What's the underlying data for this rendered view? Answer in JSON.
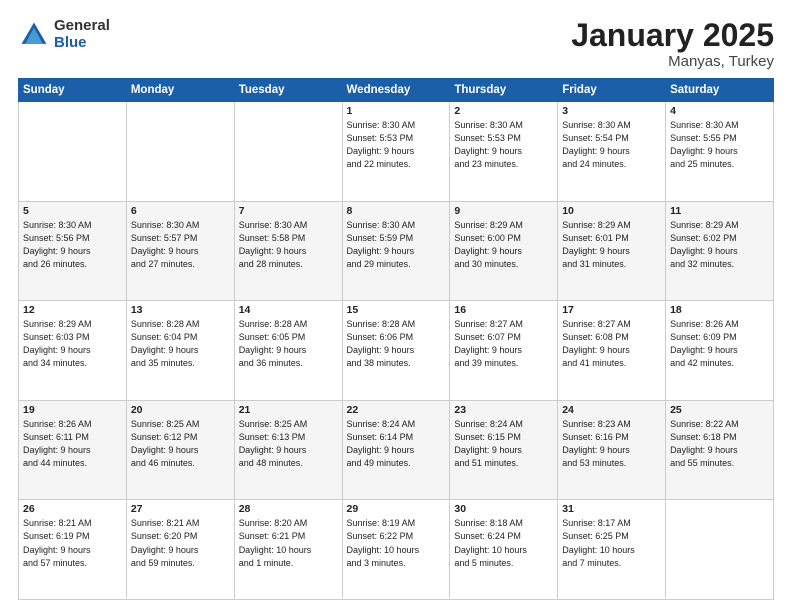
{
  "logo": {
    "general": "General",
    "blue": "Blue"
  },
  "title": {
    "month": "January 2025",
    "location": "Manyas, Turkey"
  },
  "weekdays": [
    "Sunday",
    "Monday",
    "Tuesday",
    "Wednesday",
    "Thursday",
    "Friday",
    "Saturday"
  ],
  "weeks": [
    [
      {
        "day": "",
        "info": ""
      },
      {
        "day": "",
        "info": ""
      },
      {
        "day": "",
        "info": ""
      },
      {
        "day": "1",
        "info": "Sunrise: 8:30 AM\nSunset: 5:53 PM\nDaylight: 9 hours\nand 22 minutes."
      },
      {
        "day": "2",
        "info": "Sunrise: 8:30 AM\nSunset: 5:53 PM\nDaylight: 9 hours\nand 23 minutes."
      },
      {
        "day": "3",
        "info": "Sunrise: 8:30 AM\nSunset: 5:54 PM\nDaylight: 9 hours\nand 24 minutes."
      },
      {
        "day": "4",
        "info": "Sunrise: 8:30 AM\nSunset: 5:55 PM\nDaylight: 9 hours\nand 25 minutes."
      }
    ],
    [
      {
        "day": "5",
        "info": "Sunrise: 8:30 AM\nSunset: 5:56 PM\nDaylight: 9 hours\nand 26 minutes."
      },
      {
        "day": "6",
        "info": "Sunrise: 8:30 AM\nSunset: 5:57 PM\nDaylight: 9 hours\nand 27 minutes."
      },
      {
        "day": "7",
        "info": "Sunrise: 8:30 AM\nSunset: 5:58 PM\nDaylight: 9 hours\nand 28 minutes."
      },
      {
        "day": "8",
        "info": "Sunrise: 8:30 AM\nSunset: 5:59 PM\nDaylight: 9 hours\nand 29 minutes."
      },
      {
        "day": "9",
        "info": "Sunrise: 8:29 AM\nSunset: 6:00 PM\nDaylight: 9 hours\nand 30 minutes."
      },
      {
        "day": "10",
        "info": "Sunrise: 8:29 AM\nSunset: 6:01 PM\nDaylight: 9 hours\nand 31 minutes."
      },
      {
        "day": "11",
        "info": "Sunrise: 8:29 AM\nSunset: 6:02 PM\nDaylight: 9 hours\nand 32 minutes."
      }
    ],
    [
      {
        "day": "12",
        "info": "Sunrise: 8:29 AM\nSunset: 6:03 PM\nDaylight: 9 hours\nand 34 minutes."
      },
      {
        "day": "13",
        "info": "Sunrise: 8:28 AM\nSunset: 6:04 PM\nDaylight: 9 hours\nand 35 minutes."
      },
      {
        "day": "14",
        "info": "Sunrise: 8:28 AM\nSunset: 6:05 PM\nDaylight: 9 hours\nand 36 minutes."
      },
      {
        "day": "15",
        "info": "Sunrise: 8:28 AM\nSunset: 6:06 PM\nDaylight: 9 hours\nand 38 minutes."
      },
      {
        "day": "16",
        "info": "Sunrise: 8:27 AM\nSunset: 6:07 PM\nDaylight: 9 hours\nand 39 minutes."
      },
      {
        "day": "17",
        "info": "Sunrise: 8:27 AM\nSunset: 6:08 PM\nDaylight: 9 hours\nand 41 minutes."
      },
      {
        "day": "18",
        "info": "Sunrise: 8:26 AM\nSunset: 6:09 PM\nDaylight: 9 hours\nand 42 minutes."
      }
    ],
    [
      {
        "day": "19",
        "info": "Sunrise: 8:26 AM\nSunset: 6:11 PM\nDaylight: 9 hours\nand 44 minutes."
      },
      {
        "day": "20",
        "info": "Sunrise: 8:25 AM\nSunset: 6:12 PM\nDaylight: 9 hours\nand 46 minutes."
      },
      {
        "day": "21",
        "info": "Sunrise: 8:25 AM\nSunset: 6:13 PM\nDaylight: 9 hours\nand 48 minutes."
      },
      {
        "day": "22",
        "info": "Sunrise: 8:24 AM\nSunset: 6:14 PM\nDaylight: 9 hours\nand 49 minutes."
      },
      {
        "day": "23",
        "info": "Sunrise: 8:24 AM\nSunset: 6:15 PM\nDaylight: 9 hours\nand 51 minutes."
      },
      {
        "day": "24",
        "info": "Sunrise: 8:23 AM\nSunset: 6:16 PM\nDaylight: 9 hours\nand 53 minutes."
      },
      {
        "day": "25",
        "info": "Sunrise: 8:22 AM\nSunset: 6:18 PM\nDaylight: 9 hours\nand 55 minutes."
      }
    ],
    [
      {
        "day": "26",
        "info": "Sunrise: 8:21 AM\nSunset: 6:19 PM\nDaylight: 9 hours\nand 57 minutes."
      },
      {
        "day": "27",
        "info": "Sunrise: 8:21 AM\nSunset: 6:20 PM\nDaylight: 9 hours\nand 59 minutes."
      },
      {
        "day": "28",
        "info": "Sunrise: 8:20 AM\nSunset: 6:21 PM\nDaylight: 10 hours\nand 1 minute."
      },
      {
        "day": "29",
        "info": "Sunrise: 8:19 AM\nSunset: 6:22 PM\nDaylight: 10 hours\nand 3 minutes."
      },
      {
        "day": "30",
        "info": "Sunrise: 8:18 AM\nSunset: 6:24 PM\nDaylight: 10 hours\nand 5 minutes."
      },
      {
        "day": "31",
        "info": "Sunrise: 8:17 AM\nSunset: 6:25 PM\nDaylight: 10 hours\nand 7 minutes."
      },
      {
        "day": "",
        "info": ""
      }
    ]
  ]
}
